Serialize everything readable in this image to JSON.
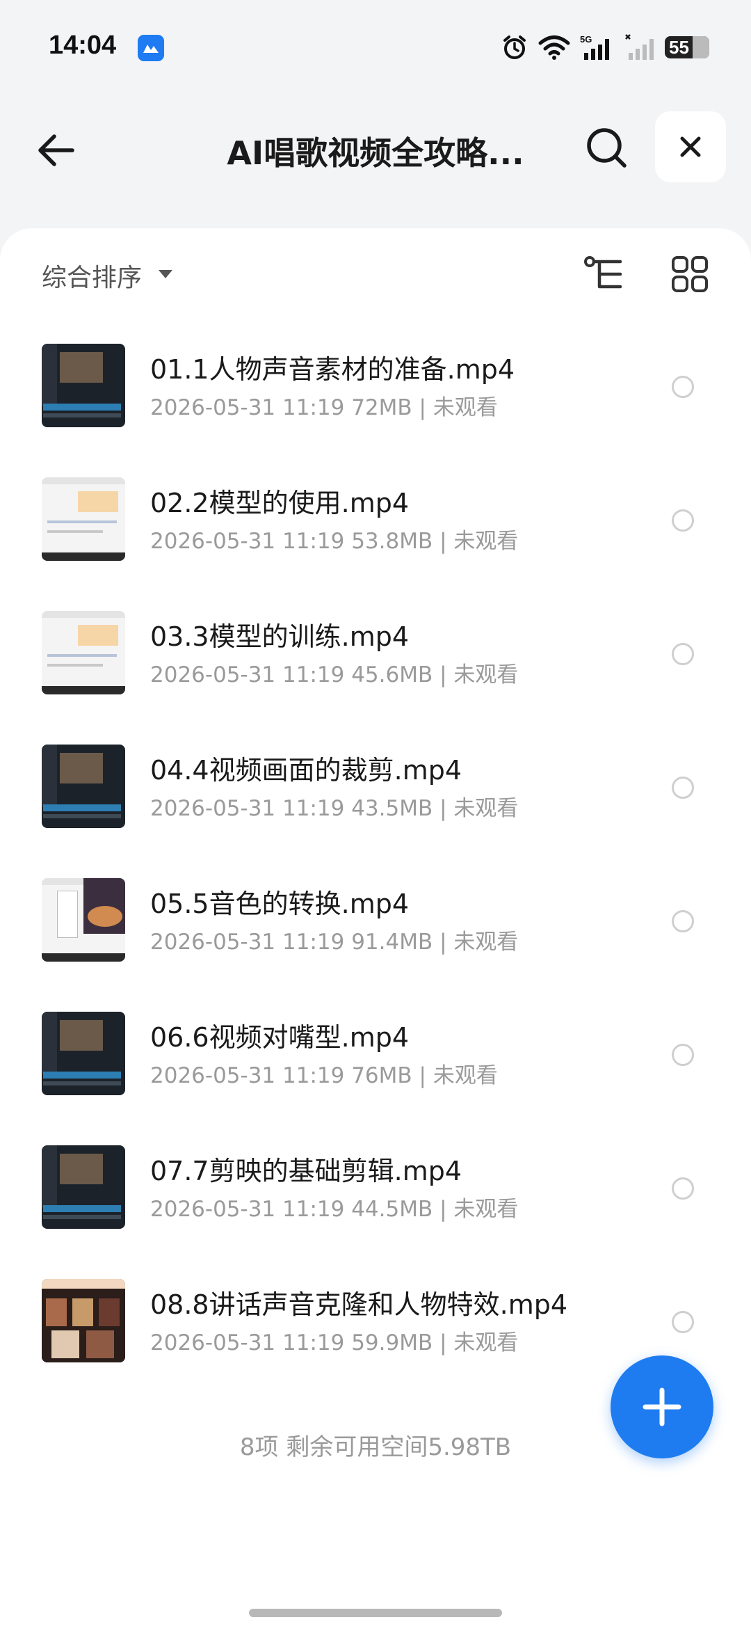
{
  "status_bar": {
    "time": "14:04",
    "battery": "55",
    "network": "5G"
  },
  "header": {
    "title": "AI唱歌视频全攻略...",
    "icons": [
      "back-arrow-icon",
      "search-icon",
      "close-icon"
    ]
  },
  "toolbar": {
    "sort_label": "综合排序",
    "icons": [
      "tree-view-icon",
      "grid-view-icon"
    ]
  },
  "files": [
    {
      "name": "01.1人物声音素材的准备.mp4",
      "meta": "2026-05-31 11:19  72MB | 未观看",
      "thumb": "dark"
    },
    {
      "name": "02.2模型的使用.mp4",
      "meta": "2026-05-31 11:19  53.8MB | 未观看",
      "thumb": "light"
    },
    {
      "name": "03.3模型的训练.mp4",
      "meta": "2026-05-31 11:19  45.6MB | 未观看",
      "thumb": "light"
    },
    {
      "name": "04.4视频画面的裁剪.mp4",
      "meta": "2026-05-31 11:19  43.5MB | 未观看",
      "thumb": "dark"
    },
    {
      "name": "05.5音色的转换.mp4",
      "meta": "2026-05-31 11:19  91.4MB | 未观看",
      "thumb": "night"
    },
    {
      "name": "06.6视频对嘴型.mp4",
      "meta": "2026-05-31 11:19  76MB | 未观看",
      "thumb": "dark"
    },
    {
      "name": "07.7剪映的基础剪辑.mp4",
      "meta": "2026-05-31 11:19  44.5MB | 未观看",
      "thumb": "dark"
    },
    {
      "name": "08.8讲话声音克隆和人物特效.mp4",
      "meta": "2026-05-31 11:19  59.9MB | 未观看",
      "thumb": "poster"
    }
  ],
  "footer": {
    "summary": "8项 剩余可用空间5.98TB"
  },
  "colors": {
    "accent": "#1f7cf0",
    "background": "#f3f4f6",
    "card": "#ffffff"
  }
}
